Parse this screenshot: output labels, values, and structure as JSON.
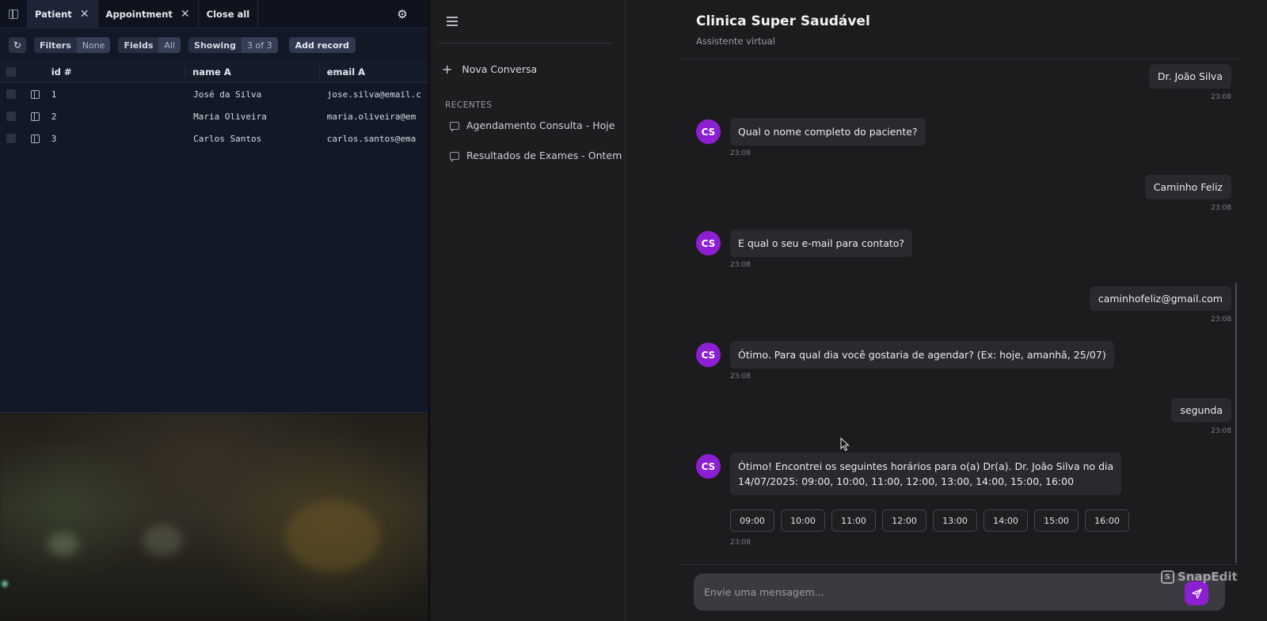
{
  "db": {
    "tabs": [
      {
        "label": "Patient",
        "active": true
      },
      {
        "label": "Appointment",
        "active": false
      }
    ],
    "close_all": "Close all",
    "toolbar": {
      "filters_label": "Filters",
      "filters_value": "None",
      "fields_label": "Fields",
      "fields_value": "All",
      "showing_label": "Showing",
      "showing_value": "3 of 3",
      "add_record": "Add record"
    },
    "columns": [
      "id #",
      "name A",
      "email A"
    ],
    "rows": [
      {
        "id": "1",
        "name": "José da Silva",
        "email": "jose.silva@email.c"
      },
      {
        "id": "2",
        "name": "Maria Oliveira",
        "email": "maria.oliveira@em"
      },
      {
        "id": "3",
        "name": "Carlos Santos",
        "email": "carlos.santos@ema"
      }
    ]
  },
  "sidebar": {
    "new_chat": "Nova Conversa",
    "recent_heading": "RECENTES",
    "conversations": [
      "Agendamento Consulta - Hoje",
      "Resultados de Exames - Ontem"
    ]
  },
  "chat": {
    "title": "Clinica Super Saudável",
    "subtitle": "Assistente virtual",
    "bot_initials": "CS",
    "messages": [
      {
        "from": "user",
        "text": "Dr. João Silva",
        "time": "23:08"
      },
      {
        "from": "bot",
        "text": "Qual o nome completo do paciente?",
        "time": "23:08"
      },
      {
        "from": "user",
        "text": "Caminho Feliz",
        "time": "23:08"
      },
      {
        "from": "bot",
        "text": "E qual o seu e-mail para contato?",
        "time": "23:08"
      },
      {
        "from": "user",
        "text": "caminhofeliz@gmail.com",
        "time": "23:08"
      },
      {
        "from": "bot",
        "text": "Ótimo. Para qual dia você gostaria de agendar? (Ex: hoje, amanhã, 25/07)",
        "time": "23:08"
      },
      {
        "from": "user",
        "text": "segunda",
        "time": "23:08"
      },
      {
        "from": "bot",
        "text_line1": "Ótimo! Encontrei os seguintes horários para o(a) Dr(a). Dr. João Silva no dia",
        "text_line2": "14/07/2025: 09:00, 10:00, 11:00, 12:00, 13:00, 14:00, 15:00, 16:00",
        "time": "23:08"
      }
    ],
    "slots": [
      "09:00",
      "10:00",
      "11:00",
      "12:00",
      "13:00",
      "14:00",
      "15:00",
      "16:00"
    ],
    "input_placeholder": "Envie uma mensagem...",
    "accent": "#8d1fd2"
  },
  "watermark": "SnapEdit"
}
